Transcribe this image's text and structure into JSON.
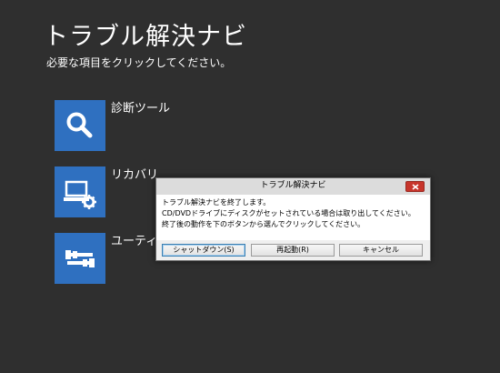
{
  "app": {
    "title": "トラブル解決ナビ",
    "subtitle": "必要な項目をクリックしてください。"
  },
  "menu": {
    "tile_color": "#2f70c0",
    "items": [
      {
        "label": "診断ツール",
        "icon": "magnifier-icon"
      },
      {
        "label": "リカバリ",
        "icon": "computer-gear-icon"
      },
      {
        "label": "ユーティ",
        "icon": "tools-icon"
      }
    ]
  },
  "dialog": {
    "title": "トラブル解決ナビ",
    "lines": [
      "トラブル解決ナビを終了します。",
      "CD/DVDドライブにディスクがセットされている場合は取り出してください。",
      "終了後の動作を下のボタンから選んでクリックしてください。"
    ],
    "buttons": {
      "shutdown": "シャットダウン(S)",
      "restart": "再起動(R)",
      "cancel": "キャンセル"
    },
    "close_icon": "close-icon",
    "close_color": "#c7352b"
  }
}
